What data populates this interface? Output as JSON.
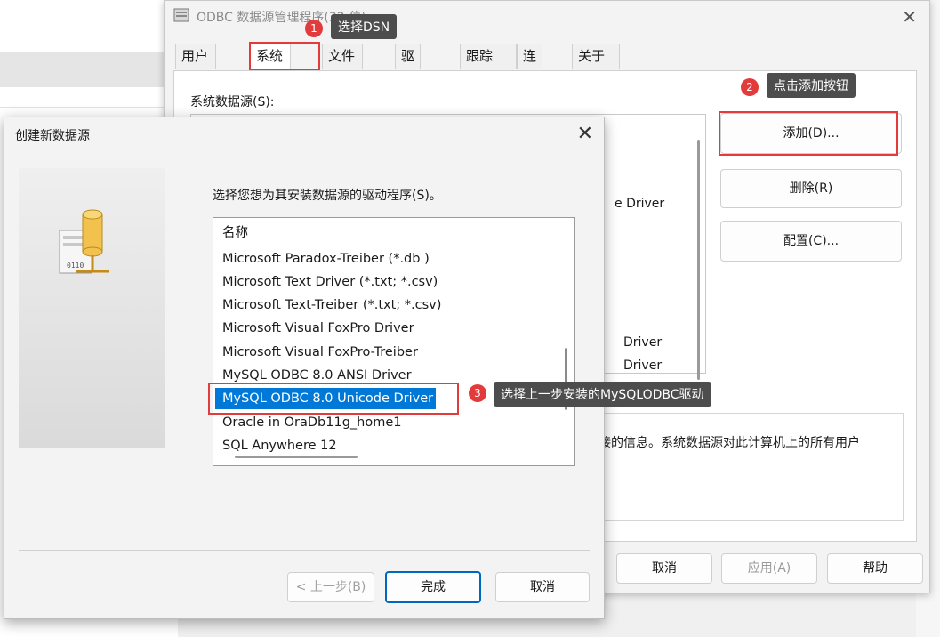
{
  "odbc": {
    "title": "ODBC 数据源管理程序(32 位)",
    "tabs": [
      "用户 DSN",
      "系统 DSN",
      "文件 DSN",
      "驱动程序",
      "跟踪",
      "连接池",
      "关于"
    ],
    "active_tab": "系统 DSN",
    "system_ds_label": "系统数据源(S):",
    "list_fragments": [
      "e Driver",
      "Driver",
      "Driver"
    ],
    "buttons": {
      "add": "添加(D)...",
      "remove": "删除(R)",
      "configure": "配置(C)..."
    },
    "info_text": "接的信息。系统数据源对此计算机上的所有用户",
    "footer": {
      "cancel": "取消",
      "apply": "应用(A)",
      "help": "帮助"
    }
  },
  "create_dialog": {
    "title": "创建新数据源",
    "prompt": "选择您想为其安装数据源的驱动程序(S)。",
    "column_header": "名称",
    "drivers": [
      "Microsoft Paradox-Treiber (*.db )",
      "Microsoft Text Driver (*.txt; *.csv)",
      "Microsoft Text-Treiber (*.txt; *.csv)",
      "Microsoft Visual FoxPro Driver",
      "Microsoft Visual FoxPro-Treiber",
      "MySQL ODBC 8.0 ANSI Driver",
      "MySQL ODBC 8.0 Unicode Driver",
      "Oracle in OraDb11g_home1",
      "SQL Anywhere 12"
    ],
    "selected_driver": "MySQL ODBC 8.0 Unicode Driver",
    "buttons": {
      "back": "< 上一步(B)",
      "finish": "完成",
      "cancel": "取消"
    }
  },
  "annotations": [
    {
      "num": "1",
      "text": "选择DSN"
    },
    {
      "num": "2",
      "text": "点击添加按钮"
    },
    {
      "num": "3",
      "text": "选择上一步安装的MySQLODBC驱动"
    }
  ],
  "colors": {
    "highlight": "#0078d7",
    "annotation_red": "#e23b3b",
    "callout_bg": "#4d4d4d"
  }
}
